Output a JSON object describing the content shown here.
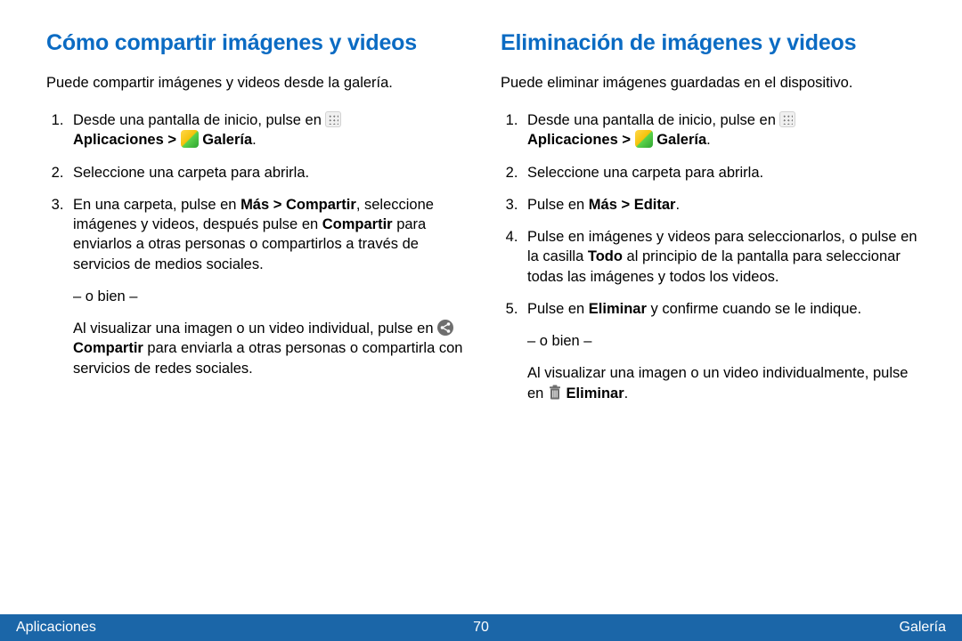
{
  "left": {
    "heading": "Cómo compartir imágenes y videos",
    "intro": "Puede compartir imágenes y videos desde la galería.",
    "step1_a": "Desde una pantalla de inicio, pulse en ",
    "step1_apps": "Aplicaciones",
    "step1_gt": " > ",
    "step1_gal": "Galería",
    "step1_dot": ".",
    "step2": "Seleccione una carpeta para abrirla.",
    "step3_a": "En una carpeta, pulse en ",
    "step3_mc": "Más > Compartir",
    "step3_b": ", seleccione imágenes y videos, después pulse en ",
    "step3_comp": "Compartir",
    "step3_c": " para enviarlos a otras personas o compartirlos a través de servicios de medios sociales.",
    "or": "– o bien –",
    "alt_a": "Al visualizar una imagen o un video individual, pulse en ",
    "alt_comp": "Compartir",
    "alt_b": " para enviarla a otras personas o compartirla con servicios de redes sociales."
  },
  "right": {
    "heading": "Eliminación de imágenes y videos",
    "intro": "Puede eliminar imágenes guardadas en el dispositivo.",
    "step1_a": "Desde una pantalla de inicio, pulse en ",
    "step1_apps": "Aplicaciones",
    "step1_gt": " > ",
    "step1_gal": "Galería",
    "step1_dot": ".",
    "step2": "Seleccione una carpeta para abrirla.",
    "step3_a": "Pulse en ",
    "step3_me": "Más > Editar",
    "step3_dot": ".",
    "step4_a": "Pulse en imágenes y videos para seleccionarlos, o pulse en la casilla ",
    "step4_todo": "Todo",
    "step4_b": " al principio de la pantalla para seleccionar todas las imágenes y todos los videos.",
    "step5_a": "Pulse en ",
    "step5_el": "Eliminar",
    "step5_b": " y confirme cuando se le indique.",
    "or": "– o bien –",
    "alt_a": "Al visualizar una imagen o un video individualmente, pulse en ",
    "alt_el": "Eliminar",
    "alt_dot": "."
  },
  "footer": {
    "left": "Aplicaciones",
    "page": "70",
    "right": "Galería"
  }
}
